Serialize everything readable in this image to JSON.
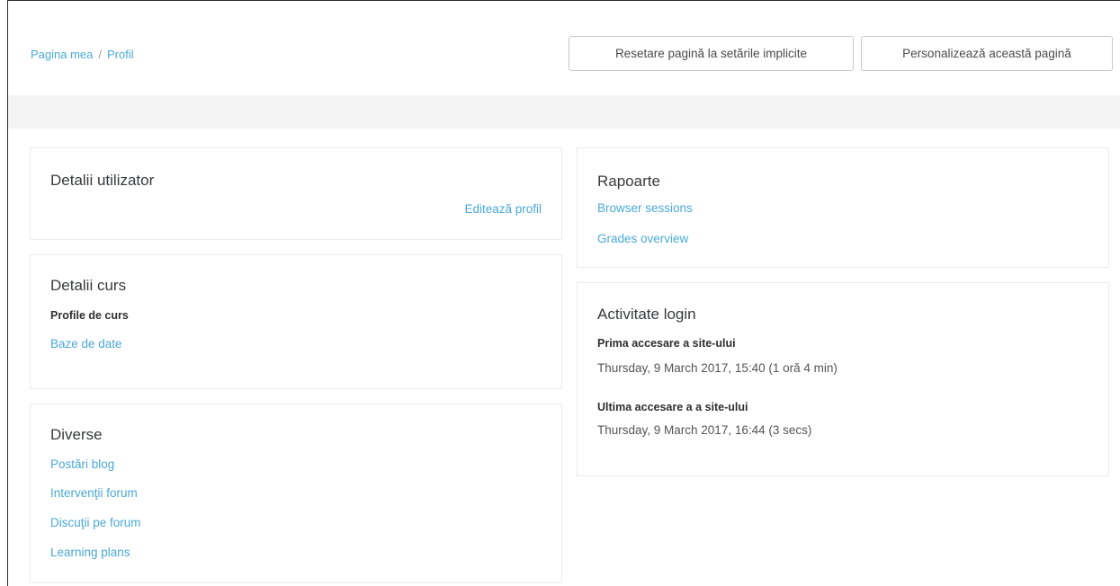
{
  "breadcrumb": {
    "home": "Pagina mea",
    "separator": "/",
    "current": "Profil"
  },
  "header_buttons": {
    "reset": "Resetare pagină la setările implicite",
    "customize": "Personalizează această pagină"
  },
  "user_details": {
    "title": "Detalii utilizator",
    "edit_profile": "Editează profil"
  },
  "course_details": {
    "title": "Detalii curs",
    "subtitle": "Profile de curs",
    "link": "Baze de date"
  },
  "misc": {
    "title": "Diverse",
    "links": [
      "Postări blog",
      "Intervenţii forum",
      "Discuţii pe forum",
      "Learning plans"
    ]
  },
  "reports": {
    "title": "Rapoarte",
    "links": [
      "Browser sessions",
      "Grades overview"
    ]
  },
  "login_activity": {
    "title": "Activitate login",
    "first_label": "Prima accesare a site-ului",
    "first_value": "Thursday, 9 March 2017, 15:40  (1 oră 4 min)",
    "last_label": "Ultima accesare a a site-ului",
    "last_value": "Thursday, 9 March 2017, 16:44  (3 secs)"
  },
  "colors": {
    "link": "#4aa9d8",
    "band": "#f4f4f4",
    "border": "#ececec"
  }
}
